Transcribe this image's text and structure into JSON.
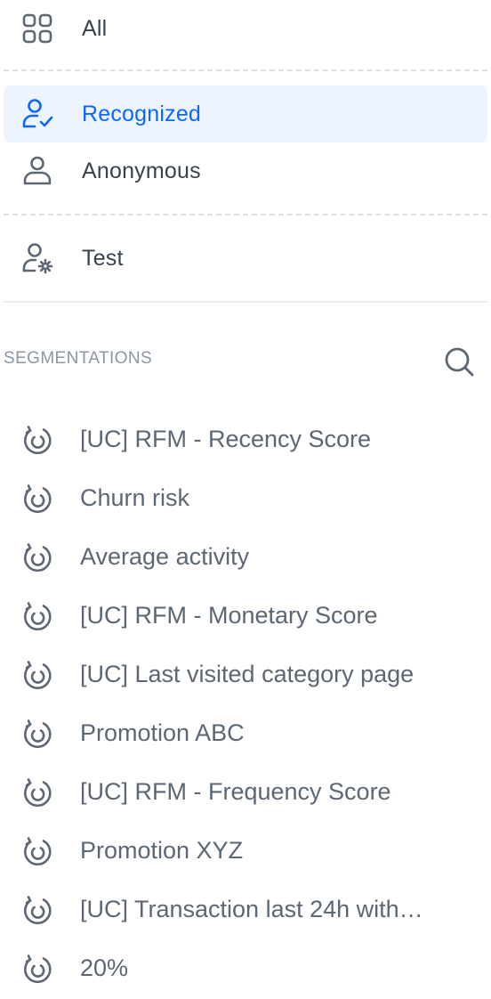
{
  "filters": {
    "all": {
      "label": "All",
      "icon": "grid-icon"
    },
    "recognized": {
      "label": "Recognized",
      "icon": "user-check-icon"
    },
    "anonymous": {
      "label": "Anonymous",
      "icon": "user-icon"
    },
    "test": {
      "label": "Test",
      "icon": "user-settings-icon"
    }
  },
  "segmentations": {
    "title": "SEGMENTATIONS",
    "search_icon": "search-icon",
    "items": [
      {
        "label": "[UC] RFM - Recency Score"
      },
      {
        "label": "Churn risk"
      },
      {
        "label": "Average activity"
      },
      {
        "label": "[UC] RFM - Monetary Score"
      },
      {
        "label": "[UC] Last visited category page"
      },
      {
        "label": "Promotion ABC"
      },
      {
        "label": "[UC] RFM - Frequency Score"
      },
      {
        "label": "Promotion XYZ"
      },
      {
        "label": "[UC] Transaction last 24h with…"
      },
      {
        "label": "20%"
      }
    ]
  },
  "colors": {
    "accent": "#0b68ff",
    "active_bg": "#eef4fd",
    "text": "#384350",
    "muted": "#8c97a1",
    "segment_text": "#5d6773"
  }
}
